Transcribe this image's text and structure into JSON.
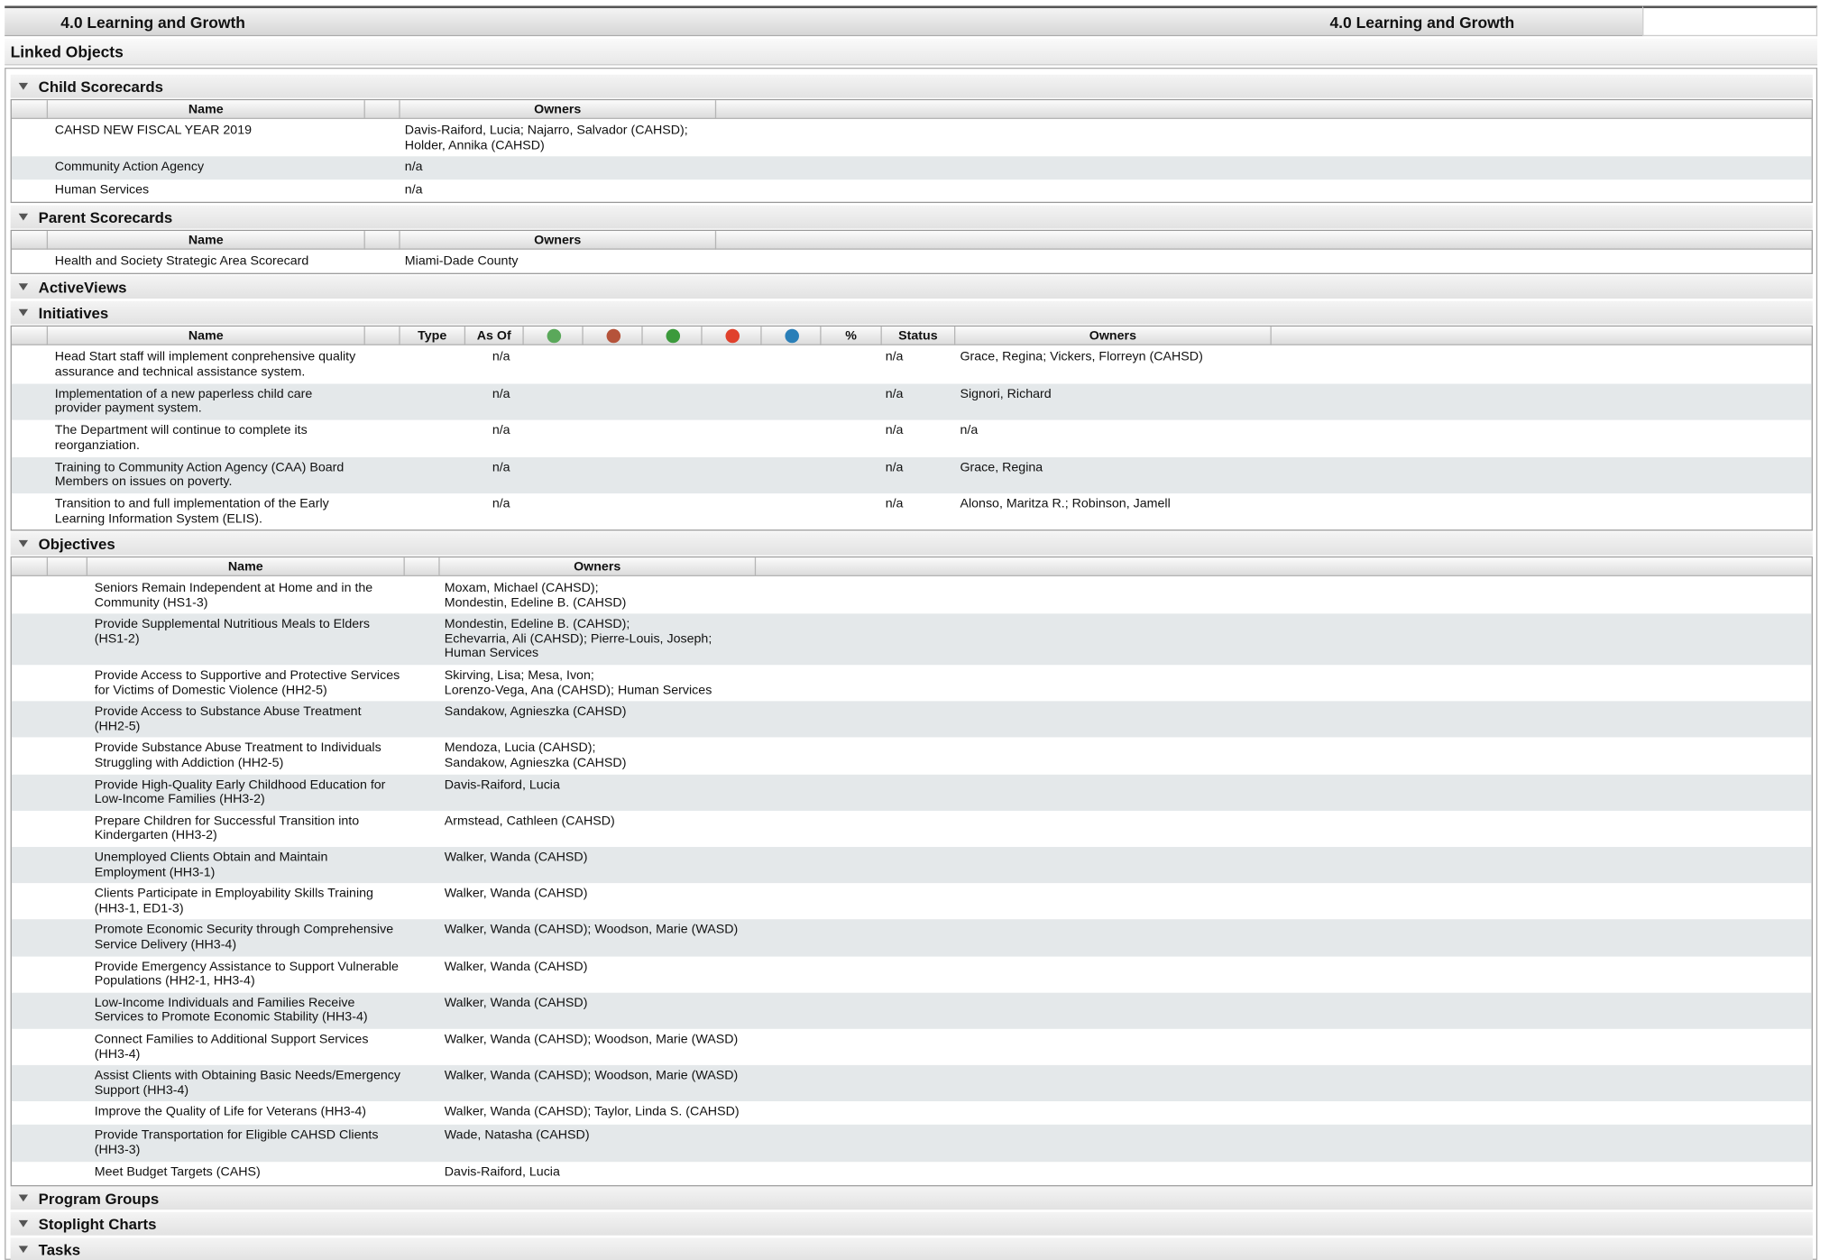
{
  "header": {
    "title_left": "4.0 Learning and Growth",
    "title_right": "4.0 Learning and Growth"
  },
  "linked_objects": "Linked Objects",
  "sections": {
    "child": "Child Scorecards",
    "parent": "Parent Scorecards",
    "active": "ActiveViews",
    "initiatives": "Initiatives",
    "objectives": "Objectives",
    "program": "Program Groups",
    "stoplight": "Stoplight Charts",
    "tasks": "Tasks"
  },
  "columns": {
    "name": "Name",
    "owners": "Owners",
    "type": "Type",
    "asof": "As Of",
    "pct": "%",
    "status": "Status"
  },
  "initiative_icons": [
    {
      "name": "money-icon",
      "color": "#5aa85a"
    },
    {
      "name": "alarm-clock-icon",
      "color": "#b5533a"
    },
    {
      "name": "checkmark-icon",
      "color": "#3c9a3c"
    },
    {
      "name": "alert-icon",
      "color": "#e0412c"
    },
    {
      "name": "target-icon",
      "color": "#2a7fb8"
    }
  ],
  "child_scorecards": [
    {
      "name": "CAHSD NEW FISCAL YEAR 2019",
      "owners": "Davis-Raiford, Lucia; Najarro, Salvador (CAHSD);\nHolder, Annika (CAHSD)"
    },
    {
      "name": "Community Action Agency",
      "owners": "n/a"
    },
    {
      "name": "Human Services",
      "owners": "n/a"
    }
  ],
  "parent_scorecards": [
    {
      "name": "Health and Society Strategic Area Scorecard",
      "owners": "Miami-Dade County"
    }
  ],
  "initiatives": [
    {
      "name": "Head Start staff will implement conprehensive quality\nassurance and technical assistance system.",
      "asof": "n/a",
      "status": "n/a",
      "owners": "Grace, Regina; Vickers, Florreyn (CAHSD)"
    },
    {
      "name": "Implementation of a new paperless child care\nprovider payment system.",
      "asof": "n/a",
      "status": "n/a",
      "owners": "Signori, Richard"
    },
    {
      "name": "The Department will continue to complete its\nreorganziation.",
      "asof": "n/a",
      "status": "n/a",
      "owners": "n/a"
    },
    {
      "name": "Training to Community Action Agency (CAA) Board\nMembers on issues on poverty.",
      "asof": "n/a",
      "status": "n/a",
      "owners": "Grace, Regina"
    },
    {
      "name": "Transition to and full implementation of the Early\nLearning Information System (ELIS).",
      "asof": "n/a",
      "status": "n/a",
      "owners": "Alonso, Maritza R.; Robinson, Jamell"
    }
  ],
  "objectives": [
    {
      "name": "Seniors Remain Independent at Home and in the\nCommunity (HS1-3)",
      "owners": "Moxam, Michael (CAHSD);\nMondestin, Edeline B. (CAHSD)"
    },
    {
      "name": "Provide Supplemental Nutritious Meals to Elders\n(HS1-2)",
      "owners": "Mondestin, Edeline B. (CAHSD);\nEchevarria, Ali (CAHSD); Pierre-Louis, Joseph;\nHuman Services"
    },
    {
      "name": "Provide Access to Supportive and Protective Services\nfor Victims of Domestic Violence (HH2-5)",
      "owners": "Skirving, Lisa; Mesa, Ivon;\nLorenzo-Vega, Ana (CAHSD); Human Services"
    },
    {
      "name": "Provide Access to Substance Abuse Treatment\n(HH2-5)",
      "owners": "Sandakow, Agnieszka (CAHSD)"
    },
    {
      "name": "Provide Substance Abuse Treatment to Individuals\nStruggling with Addiction (HH2-5)",
      "owners": "Mendoza, Lucia (CAHSD);\nSandakow, Agnieszka (CAHSD)"
    },
    {
      "name": "Provide High-Quality Early Childhood Education for\nLow-Income Families (HH3-2)",
      "owners": "Davis-Raiford, Lucia"
    },
    {
      "name": "Prepare Children for Successful Transition into\nKindergarten (HH3-2)",
      "owners": "Armstead, Cathleen (CAHSD)"
    },
    {
      "name": "Unemployed Clients Obtain and Maintain\nEmployment (HH3-1)",
      "owners": "Walker, Wanda (CAHSD)"
    },
    {
      "name": "Clients Participate in Employability Skills Training\n(HH3-1, ED1-3)",
      "owners": "Walker, Wanda (CAHSD)"
    },
    {
      "name": "Promote Economic Security through Comprehensive\nService Delivery (HH3-4)",
      "owners": "Walker, Wanda (CAHSD); Woodson, Marie (WASD)"
    },
    {
      "name": "Provide Emergency Assistance to Support Vulnerable\nPopulations (HH2-1, HH3-4)",
      "owners": "Walker, Wanda (CAHSD)"
    },
    {
      "name": "Low-Income Individuals and Families Receive\nServices to Promote Economic Stability (HH3-4)",
      "owners": "Walker, Wanda (CAHSD)"
    },
    {
      "name": "Connect Families to Additional Support Services\n(HH3-4)",
      "owners": "Walker, Wanda (CAHSD); Woodson, Marie (WASD)"
    },
    {
      "name": "Assist Clients with Obtaining Basic Needs/Emergency\nSupport (HH3-4)",
      "owners": "Walker, Wanda (CAHSD); Woodson, Marie (WASD)"
    },
    {
      "name": "Improve the Quality of Life for Veterans (HH3-4)",
      "owners": "Walker, Wanda (CAHSD); Taylor, Linda S. (CAHSD)"
    },
    {
      "name": "Provide Transportation for Eligible CAHSD Clients\n(HH3-3)",
      "owners": "Wade, Natasha (CAHSD)"
    },
    {
      "name": "Meet Budget Targets (CAHS)",
      "owners": "Davis-Raiford, Lucia"
    }
  ]
}
